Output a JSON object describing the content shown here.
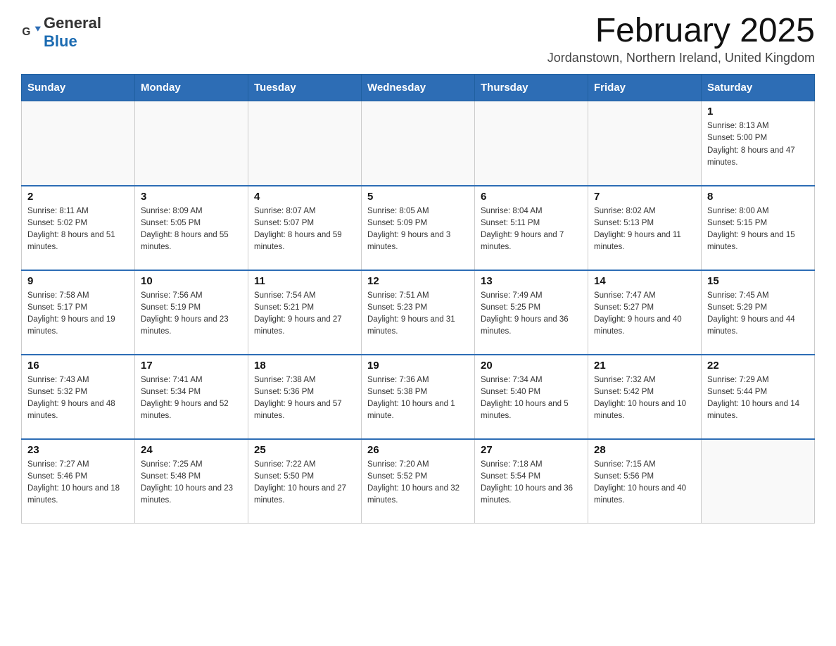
{
  "logo": {
    "text_general": "General",
    "text_blue": "Blue"
  },
  "title": "February 2025",
  "subtitle": "Jordanstown, Northern Ireland, United Kingdom",
  "days_of_week": [
    "Sunday",
    "Monday",
    "Tuesday",
    "Wednesday",
    "Thursday",
    "Friday",
    "Saturday"
  ],
  "weeks": [
    [
      {
        "day": "",
        "info": ""
      },
      {
        "day": "",
        "info": ""
      },
      {
        "day": "",
        "info": ""
      },
      {
        "day": "",
        "info": ""
      },
      {
        "day": "",
        "info": ""
      },
      {
        "day": "",
        "info": ""
      },
      {
        "day": "1",
        "info": "Sunrise: 8:13 AM\nSunset: 5:00 PM\nDaylight: 8 hours and 47 minutes."
      }
    ],
    [
      {
        "day": "2",
        "info": "Sunrise: 8:11 AM\nSunset: 5:02 PM\nDaylight: 8 hours and 51 minutes."
      },
      {
        "day": "3",
        "info": "Sunrise: 8:09 AM\nSunset: 5:05 PM\nDaylight: 8 hours and 55 minutes."
      },
      {
        "day": "4",
        "info": "Sunrise: 8:07 AM\nSunset: 5:07 PM\nDaylight: 8 hours and 59 minutes."
      },
      {
        "day": "5",
        "info": "Sunrise: 8:05 AM\nSunset: 5:09 PM\nDaylight: 9 hours and 3 minutes."
      },
      {
        "day": "6",
        "info": "Sunrise: 8:04 AM\nSunset: 5:11 PM\nDaylight: 9 hours and 7 minutes."
      },
      {
        "day": "7",
        "info": "Sunrise: 8:02 AM\nSunset: 5:13 PM\nDaylight: 9 hours and 11 minutes."
      },
      {
        "day": "8",
        "info": "Sunrise: 8:00 AM\nSunset: 5:15 PM\nDaylight: 9 hours and 15 minutes."
      }
    ],
    [
      {
        "day": "9",
        "info": "Sunrise: 7:58 AM\nSunset: 5:17 PM\nDaylight: 9 hours and 19 minutes."
      },
      {
        "day": "10",
        "info": "Sunrise: 7:56 AM\nSunset: 5:19 PM\nDaylight: 9 hours and 23 minutes."
      },
      {
        "day": "11",
        "info": "Sunrise: 7:54 AM\nSunset: 5:21 PM\nDaylight: 9 hours and 27 minutes."
      },
      {
        "day": "12",
        "info": "Sunrise: 7:51 AM\nSunset: 5:23 PM\nDaylight: 9 hours and 31 minutes."
      },
      {
        "day": "13",
        "info": "Sunrise: 7:49 AM\nSunset: 5:25 PM\nDaylight: 9 hours and 36 minutes."
      },
      {
        "day": "14",
        "info": "Sunrise: 7:47 AM\nSunset: 5:27 PM\nDaylight: 9 hours and 40 minutes."
      },
      {
        "day": "15",
        "info": "Sunrise: 7:45 AM\nSunset: 5:29 PM\nDaylight: 9 hours and 44 minutes."
      }
    ],
    [
      {
        "day": "16",
        "info": "Sunrise: 7:43 AM\nSunset: 5:32 PM\nDaylight: 9 hours and 48 minutes."
      },
      {
        "day": "17",
        "info": "Sunrise: 7:41 AM\nSunset: 5:34 PM\nDaylight: 9 hours and 52 minutes."
      },
      {
        "day": "18",
        "info": "Sunrise: 7:38 AM\nSunset: 5:36 PM\nDaylight: 9 hours and 57 minutes."
      },
      {
        "day": "19",
        "info": "Sunrise: 7:36 AM\nSunset: 5:38 PM\nDaylight: 10 hours and 1 minute."
      },
      {
        "day": "20",
        "info": "Sunrise: 7:34 AM\nSunset: 5:40 PM\nDaylight: 10 hours and 5 minutes."
      },
      {
        "day": "21",
        "info": "Sunrise: 7:32 AM\nSunset: 5:42 PM\nDaylight: 10 hours and 10 minutes."
      },
      {
        "day": "22",
        "info": "Sunrise: 7:29 AM\nSunset: 5:44 PM\nDaylight: 10 hours and 14 minutes."
      }
    ],
    [
      {
        "day": "23",
        "info": "Sunrise: 7:27 AM\nSunset: 5:46 PM\nDaylight: 10 hours and 18 minutes."
      },
      {
        "day": "24",
        "info": "Sunrise: 7:25 AM\nSunset: 5:48 PM\nDaylight: 10 hours and 23 minutes."
      },
      {
        "day": "25",
        "info": "Sunrise: 7:22 AM\nSunset: 5:50 PM\nDaylight: 10 hours and 27 minutes."
      },
      {
        "day": "26",
        "info": "Sunrise: 7:20 AM\nSunset: 5:52 PM\nDaylight: 10 hours and 32 minutes."
      },
      {
        "day": "27",
        "info": "Sunrise: 7:18 AM\nSunset: 5:54 PM\nDaylight: 10 hours and 36 minutes."
      },
      {
        "day": "28",
        "info": "Sunrise: 7:15 AM\nSunset: 5:56 PM\nDaylight: 10 hours and 40 minutes."
      },
      {
        "day": "",
        "info": ""
      }
    ]
  ]
}
